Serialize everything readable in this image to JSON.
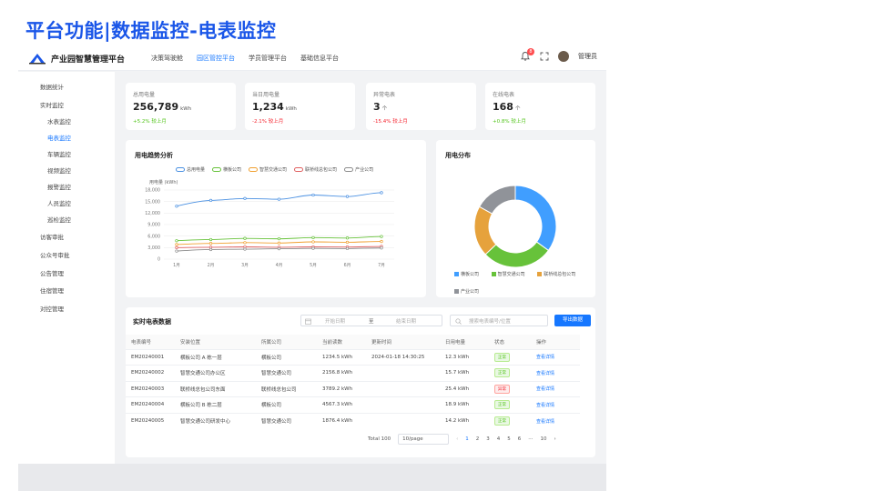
{
  "slide_title": "平台功能|数据监控-电表监控",
  "app": {
    "name": "产业园智慧管理平台",
    "nav": [
      "决策驾驶舱",
      "园区管控平台",
      "学员管理平台",
      "基础信息平台"
    ],
    "active_nav": "园区管控平台",
    "notification_count": "8",
    "user": "管理员"
  },
  "sidebar": {
    "items": [
      "数据统计",
      "实时监控",
      "水表监控",
      "电表监控",
      "车辆监控",
      "视频监控",
      "报警监控",
      "人员监控",
      "巡检监控",
      "访客审批",
      "公众号审批",
      "公告管理",
      "住宿管理",
      "对控管理"
    ],
    "active": "电表监控"
  },
  "stats": [
    {
      "label": "总用电量",
      "value": "256,789",
      "unit": "kWh",
      "trend": "+5.2% 较上月",
      "direction": "up"
    },
    {
      "label": "当日用电量",
      "value": "1,234",
      "unit": "kWh",
      "trend": "-2.1% 较上月",
      "direction": "down"
    },
    {
      "label": "异常电表",
      "value": "3",
      "unit": "个",
      "trend": "-15.4% 较上月",
      "direction": "down"
    },
    {
      "label": "在线电表",
      "value": "168",
      "unit": "个",
      "trend": "+0.8% 较上月",
      "direction": "up"
    }
  ],
  "trend_chart": {
    "title": "用电趋势分析",
    "ylabel": "用电量 (kWh)",
    "legend": [
      "总用电量",
      "横板公司",
      "智慧交通公司",
      "联桥线总包公司",
      "产业公司"
    ]
  },
  "pie_chart": {
    "title": "用电分布",
    "legend": [
      "横板公司",
      "智慧交通公司",
      "联桥线总包公司",
      "产业公司"
    ]
  },
  "chart_data": [
    {
      "type": "line",
      "title": "用电趋势分析",
      "xlabel": "",
      "ylabel": "用电量 (kWh)",
      "categories": [
        "1月",
        "2月",
        "3月",
        "4月",
        "5月",
        "6月",
        "7月"
      ],
      "ylim": [
        0,
        18000
      ],
      "yticks": [
        "0",
        "3,000",
        "6,000",
        "9,000",
        "12,000",
        "15,000",
        "18,000"
      ],
      "series": [
        {
          "name": "总用电量",
          "color": "#4a90e2",
          "values": [
            13800,
            15300,
            15800,
            15600,
            16700,
            16300,
            17300
          ]
        },
        {
          "name": "横板公司",
          "color": "#67c23a",
          "values": [
            4800,
            5100,
            5400,
            5300,
            5600,
            5500,
            5900
          ]
        },
        {
          "name": "智慧交通公司",
          "color": "#f0a030",
          "values": [
            3800,
            4100,
            4300,
            4200,
            4500,
            4400,
            4600
          ]
        },
        {
          "name": "联桥线总包公司",
          "color": "#e06060",
          "values": [
            3000,
            3100,
            3200,
            3100,
            3200,
            3150,
            3300
          ]
        },
        {
          "name": "产业公司",
          "color": "#8c8c8c",
          "values": [
            2100,
            2500,
            2600,
            2700,
            2800,
            2750,
            2900
          ]
        }
      ],
      "grid": true,
      "legend_position": "top"
    },
    {
      "type": "pie",
      "title": "用电分布",
      "categories": [
        "横板公司",
        "智慧交通公司",
        "联桥线总包公司",
        "产业公司"
      ],
      "values": [
        35,
        28,
        20,
        17
      ],
      "colors": [
        "#409eff",
        "#67c23a",
        "#e6a23c",
        "#909399"
      ],
      "legend_position": "bottom"
    }
  ],
  "table": {
    "title": "实时电表数据",
    "start_placeholder": "开始日期",
    "range_sep": "至",
    "end_placeholder": "结束日期",
    "search_placeholder": "搜索电表编号/位置",
    "export_label": "导出数据",
    "columns": [
      "电表编号",
      "安装位置",
      "所属公司",
      "当前读数",
      "更新时间",
      "日用电量",
      "状态",
      "操作"
    ],
    "rows": [
      [
        "EM20240001",
        "横板公司 A 栋一层",
        "横板公司",
        "1234.5 kWh",
        "2024-01-18 14:30:25",
        "12.3 kWh",
        "正常",
        "查看详情"
      ],
      [
        "EM20240002",
        "智慧交通公司办公区",
        "智慧交通公司",
        "2156.8 kWh",
        "",
        "15.7 kWh",
        "正常",
        "查看详情"
      ],
      [
        "EM20240003",
        "联桥线总包公司东面",
        "联桥线总包公司",
        "3789.2 kWh",
        "",
        "25.4 kWh",
        "异常",
        "查看详情"
      ],
      [
        "EM20240004",
        "横板公司 B 栋二层",
        "横板公司",
        "4567.3 kWh",
        "",
        "18.9 kWh",
        "正常",
        "查看详情"
      ],
      [
        "EM20240005",
        "智慧交通公司研发中心",
        "智慧交通公司",
        "1876.4 kWh",
        "",
        "14.2 kWh",
        "正常",
        "查看详情"
      ]
    ],
    "total": "Total 100",
    "page_size": "10/page",
    "pages": [
      "1",
      "2",
      "3",
      "4",
      "5",
      "6",
      "···",
      "10"
    ],
    "current_page": "1"
  }
}
